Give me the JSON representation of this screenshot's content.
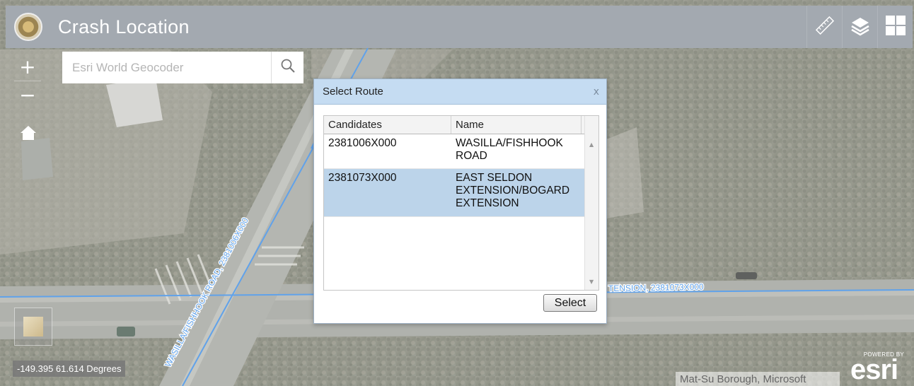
{
  "header": {
    "title": "Crash Location",
    "tools": [
      {
        "icon": "measure-icon"
      },
      {
        "icon": "layers-icon"
      },
      {
        "icon": "widget-grid-icon"
      }
    ]
  },
  "map_controls": {
    "zoom_in": "+",
    "zoom_out": "−",
    "home_icon": "home-icon",
    "search": {
      "placeholder": "Esri World Geocoder",
      "icon": "search-icon"
    },
    "basemap_icon": "basemap-thumbnail"
  },
  "map": {
    "road_labels": [
      "WASILLA/FISHHOOK ROAD, 2381006X000",
      "TENSION, 2381073X000"
    ],
    "road_color": "#3d8ee6"
  },
  "dialog": {
    "title": "Select Route",
    "close": "x",
    "columns": [
      "Candidates",
      "Name"
    ],
    "rows": [
      {
        "candidate": "2381006X000",
        "name_lines": [
          "WASILLA/FISHHOOK",
          "ROAD"
        ],
        "selected": false
      },
      {
        "candidate": "2381073X000",
        "name_lines": [
          "EAST SELDON",
          "EXTENSION/BOGARD",
          "EXTENSION"
        ],
        "selected": true
      }
    ],
    "select_button": "Select"
  },
  "footer": {
    "coordinates": "-149.395 61.614 Degrees",
    "attribution": "Mat-Su Borough, Microsoft",
    "powered_by": "POWERED BY",
    "esri": "esri"
  },
  "colors": {
    "header_bg": "#a3a9b0",
    "dialog_title_bg": "#c5dcf2",
    "selected_row": "#bcd4ea"
  }
}
